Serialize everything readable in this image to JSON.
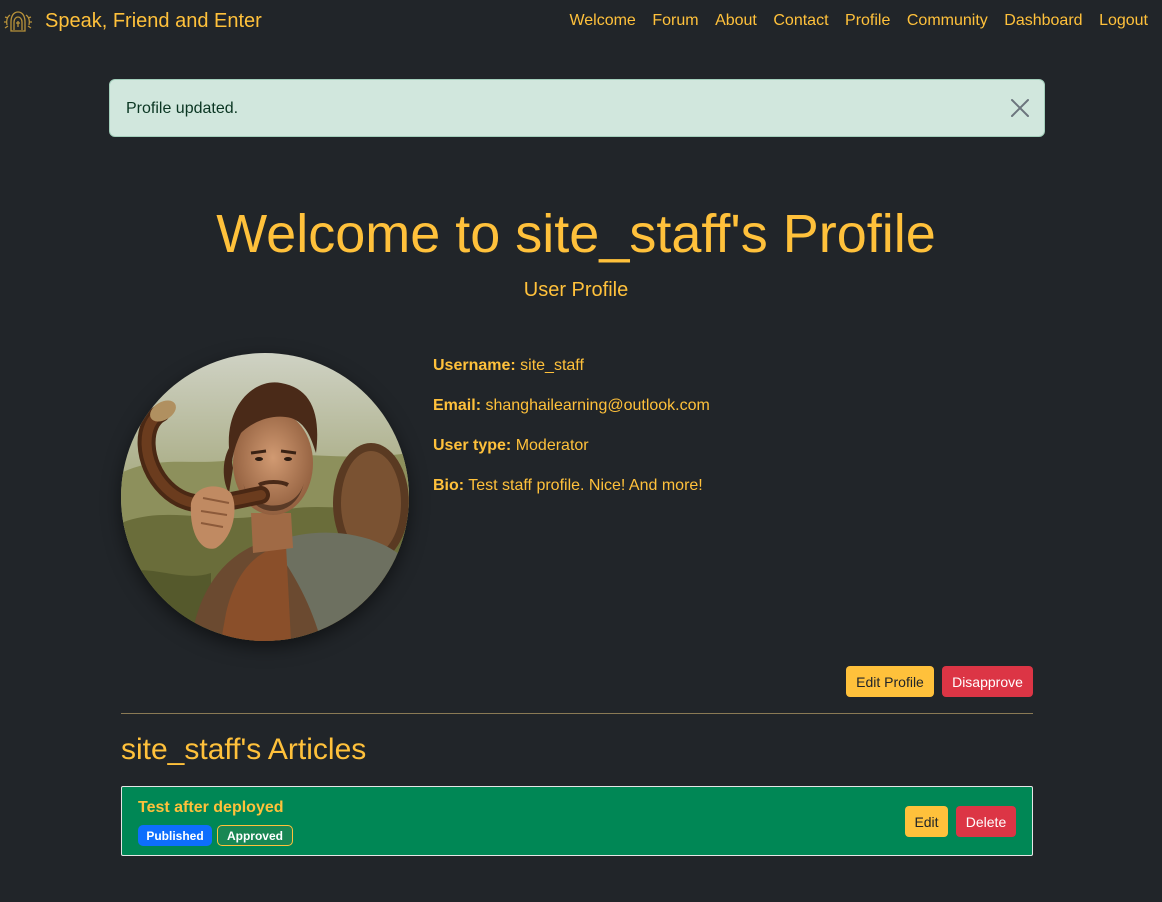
{
  "navbar": {
    "brand": "Speak, Friend and Enter",
    "links": [
      "Welcome",
      "Forum",
      "About",
      "Contact",
      "Profile",
      "Community",
      "Dashboard",
      "Logout"
    ]
  },
  "alert": {
    "message": "Profile updated.",
    "close_icon": "close-icon"
  },
  "header": {
    "title": "Welcome to site_staff's Profile",
    "subtitle": "User Profile"
  },
  "profile": {
    "username_label": "Username:",
    "username": "site_staff",
    "email_label": "Email:",
    "email": "shanghailearning@outlook.com",
    "user_type_label": "User type:",
    "user_type": "Moderator",
    "bio_label": "Bio:",
    "bio": "Test staff profile. Nice! And more!"
  },
  "actions": {
    "edit_profile": "Edit Profile",
    "disapprove": "Disapprove"
  },
  "articles": {
    "heading": "site_staff's Articles",
    "items": [
      {
        "title": "Test after deployed",
        "badges": [
          "Published",
          "Approved"
        ],
        "edit_label": "Edit",
        "delete_label": "Delete"
      }
    ]
  },
  "colors": {
    "background": "#212529",
    "accent": "#ffc13b",
    "danger": "#dc3545",
    "success_card": "#008755",
    "alert_bg": "#d1e7dd",
    "badge_primary": "#0d6efd"
  }
}
